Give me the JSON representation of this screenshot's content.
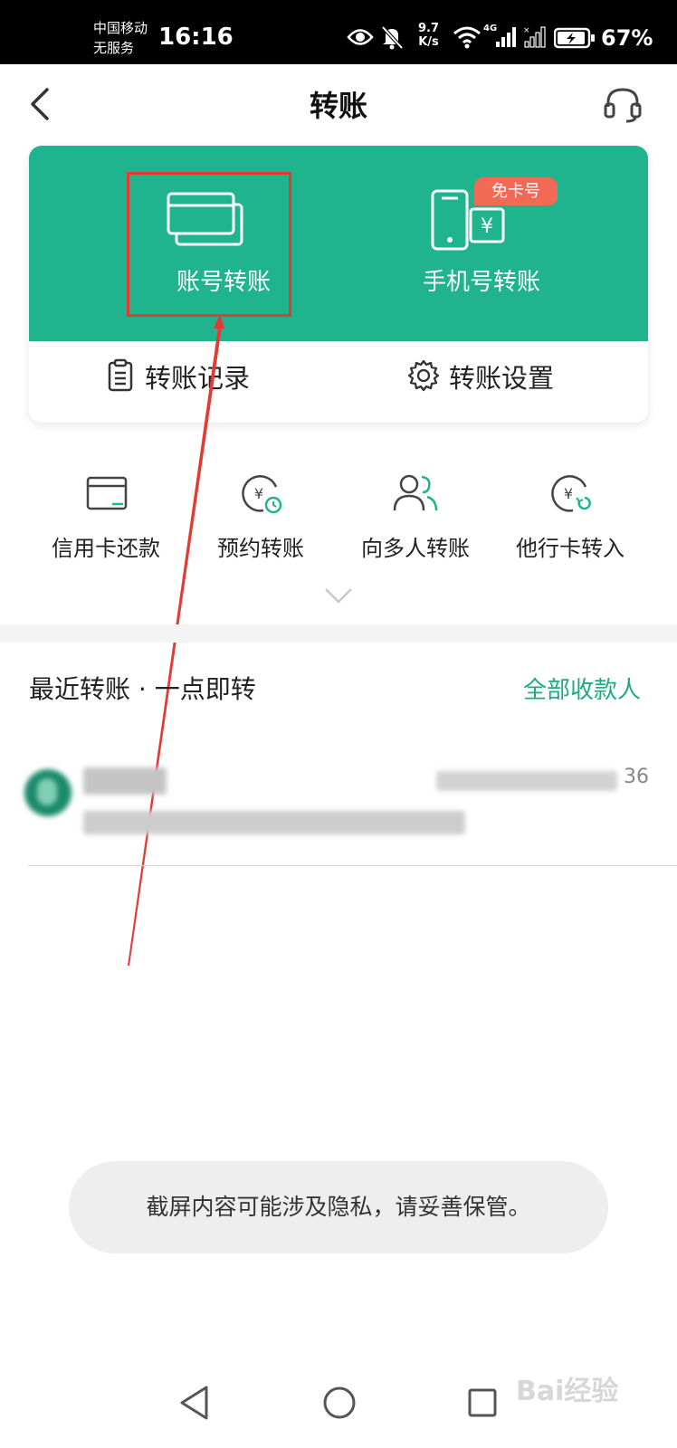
{
  "status_bar": {
    "carrier_line1": "中国移动",
    "carrier_line2": "无服务",
    "time": "16:16",
    "net_speed_value": "9.7",
    "net_speed_unit": "K/s",
    "network_type": "4G",
    "battery_percent": "67%"
  },
  "header": {
    "title": "转账",
    "back_icon": "chevron-left-icon",
    "support_icon": "headset-icon"
  },
  "transfer_card": {
    "account_transfer_label": "账号转账",
    "phone_transfer_label": "手机号转账",
    "phone_badge": "免卡号",
    "records_label": "转账记录",
    "settings_label": "转账设置",
    "accent_color": "#1fb38e"
  },
  "quick_actions": [
    {
      "label": "信用卡还款",
      "icon": "credit-card-icon"
    },
    {
      "label": "预约转账",
      "icon": "scheduled-yen-icon"
    },
    {
      "label": "向多人转账",
      "icon": "multi-user-icon"
    },
    {
      "label": "他行卡转入",
      "icon": "yen-transfer-in-icon"
    }
  ],
  "recent": {
    "title": "最近转账 · 一点即转",
    "all_payees": "全部收款人",
    "items": [
      {
        "amount_tail": "36"
      }
    ]
  },
  "toast": {
    "message": "截屏内容可能涉及隐私，请妥善保管。"
  },
  "watermark": "Bai经验"
}
